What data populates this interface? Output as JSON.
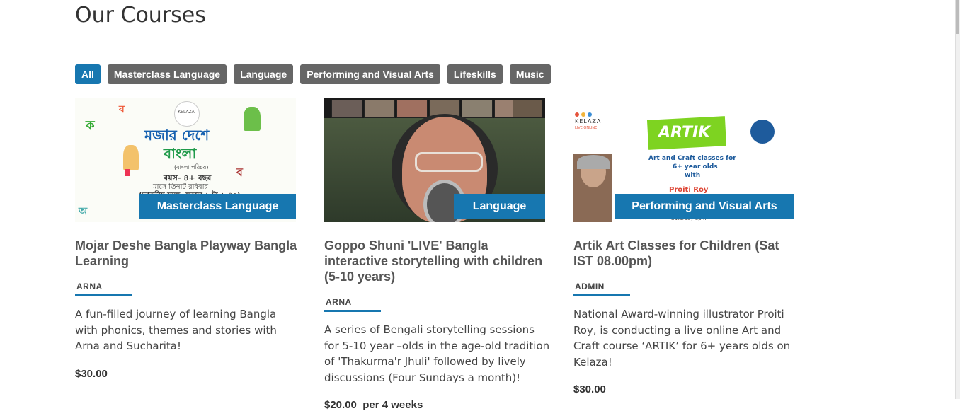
{
  "page": {
    "title": "Our Courses"
  },
  "filters": [
    "All",
    "Masterclass Language",
    "Language",
    "Performing and Visual Arts",
    "Lifeskills",
    "Music"
  ],
  "courses": [
    {
      "category": "Masterclass Language",
      "title": "Mojar Deshe Bangla Playway Bangla Learning",
      "author": "ARNA",
      "description": "A fun-filled journey of learning Bangla with phonics, themes and stories with Arna and Sucharita!",
      "price": "$30.00",
      "price_suffix": "",
      "image_text": {
        "brand": "KELAZA",
        "line1": "মজার দেশে",
        "line2": "বাংলা",
        "line3": "(বাংলা পরিচয়)",
        "line4": "বয়স- ৪+ বছর",
        "line5": "মাসে তিনটি রবিবার",
        "line6": "(ভারতীয় সময়- সকাল ৬ টা-৬.৪০)"
      }
    },
    {
      "category": "Language",
      "title": "Goppo Shuni 'LIVE' Bangla interactive storytelling with children (5-10 years)",
      "author": "ARNA",
      "description": "A series of Bengali storytelling sessions for 5-10 year –olds in the age-old tradition of 'Thakurma'r Jhuli' followed by lively discussions (Four Sundays a month)!",
      "price": "$20.00",
      "price_suffix": "per 4 weeks"
    },
    {
      "category": "Performing and Visual Arts",
      "title": "Artik Art Classes for Children (Sat IST 08.00pm)",
      "author": "ADMIN",
      "description": "National Award-winning illustrator Proiti Roy, is conducting a live online Art and Craft course ‘ARTIK’ for 6+ years olds on Kelaza!",
      "price": "$30.00",
      "price_suffix": "",
      "image_text": {
        "brand": "KELAZA",
        "brand_sub": "LIVE ONLINE",
        "headline": "ARTIK",
        "line1": "Art and Craft classes for",
        "line2": "6+ year olds",
        "line3": "with",
        "line4": "Proiti Roy",
        "line5": "Saturday 8pm"
      }
    }
  ],
  "colors": {
    "accent": "#1777b0",
    "filter_bg": "#666666"
  }
}
